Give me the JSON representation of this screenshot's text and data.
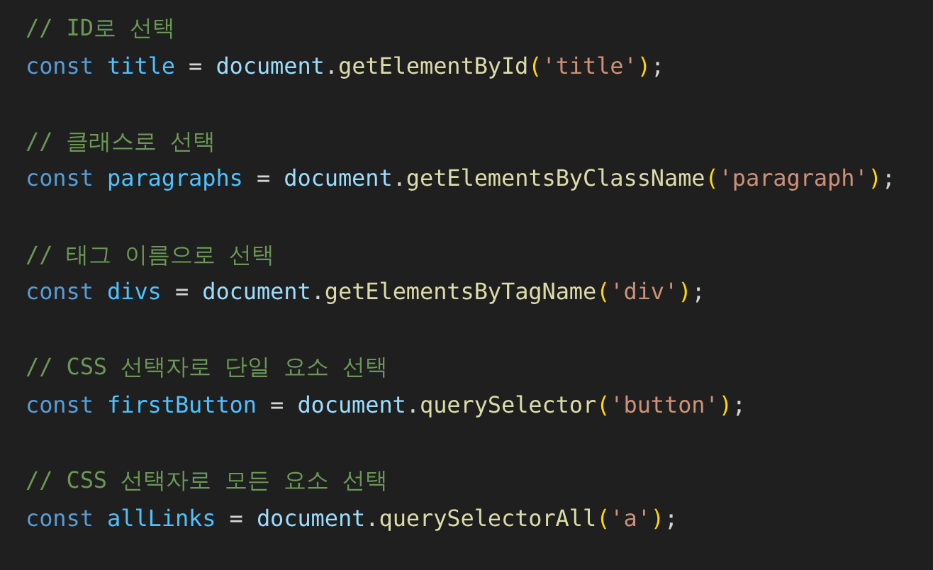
{
  "editor": {
    "lines": [
      {
        "kind": "comment",
        "text": "// ID로 선택"
      },
      {
        "kind": "code",
        "tokens": [
          {
            "kind": "keyword",
            "text": "const"
          },
          {
            "kind": "constant",
            "text": "title"
          },
          {
            "kind": "punct",
            "text": " = "
          },
          {
            "kind": "variable",
            "text": "document"
          },
          {
            "kind": "punct",
            "text": "."
          },
          {
            "kind": "method",
            "text": "getElementById"
          },
          {
            "kind": "paren",
            "text": "("
          },
          {
            "kind": "string",
            "text": "'title'"
          },
          {
            "kind": "paren",
            "text": ")"
          },
          {
            "kind": "punct",
            "text": ";"
          }
        ]
      },
      {
        "kind": "blank"
      },
      {
        "kind": "comment",
        "text": "// 클래스로 선택"
      },
      {
        "kind": "code",
        "tokens": [
          {
            "kind": "keyword",
            "text": "const"
          },
          {
            "kind": "constant",
            "text": "paragraphs"
          },
          {
            "kind": "punct",
            "text": " = "
          },
          {
            "kind": "variable",
            "text": "document"
          },
          {
            "kind": "punct",
            "text": "."
          },
          {
            "kind": "method",
            "text": "getElementsByClassName"
          },
          {
            "kind": "paren",
            "text": "("
          },
          {
            "kind": "string",
            "text": "'paragraph'"
          },
          {
            "kind": "paren",
            "text": ")"
          },
          {
            "kind": "punct",
            "text": ";"
          }
        ]
      },
      {
        "kind": "blank"
      },
      {
        "kind": "comment",
        "text": "// 태그 이름으로 선택"
      },
      {
        "kind": "code",
        "tokens": [
          {
            "kind": "keyword",
            "text": "const"
          },
          {
            "kind": "constant",
            "text": "divs"
          },
          {
            "kind": "punct",
            "text": " = "
          },
          {
            "kind": "variable",
            "text": "document"
          },
          {
            "kind": "punct",
            "text": "."
          },
          {
            "kind": "method",
            "text": "getElementsByTagName"
          },
          {
            "kind": "paren",
            "text": "("
          },
          {
            "kind": "string",
            "text": "'div'"
          },
          {
            "kind": "paren",
            "text": ")"
          },
          {
            "kind": "punct",
            "text": ";"
          }
        ]
      },
      {
        "kind": "blank"
      },
      {
        "kind": "comment",
        "text": "// CSS 선택자로 단일 요소 선택"
      },
      {
        "kind": "code",
        "tokens": [
          {
            "kind": "keyword",
            "text": "const"
          },
          {
            "kind": "constant",
            "text": "firstButton"
          },
          {
            "kind": "punct",
            "text": " = "
          },
          {
            "kind": "variable",
            "text": "document"
          },
          {
            "kind": "punct",
            "text": "."
          },
          {
            "kind": "method",
            "text": "querySelector"
          },
          {
            "kind": "paren",
            "text": "("
          },
          {
            "kind": "string",
            "text": "'button'"
          },
          {
            "kind": "paren",
            "text": ")"
          },
          {
            "kind": "punct",
            "text": ";"
          }
        ]
      },
      {
        "kind": "blank"
      },
      {
        "kind": "comment",
        "text": "// CSS 선택자로 모든 요소 선택"
      },
      {
        "kind": "code",
        "tokens": [
          {
            "kind": "keyword",
            "text": "const"
          },
          {
            "kind": "constant",
            "text": "allLinks"
          },
          {
            "kind": "punct",
            "text": " = "
          },
          {
            "kind": "variable",
            "text": "document"
          },
          {
            "kind": "punct",
            "text": "."
          },
          {
            "kind": "method",
            "text": "querySelectorAll"
          },
          {
            "kind": "paren",
            "text": "("
          },
          {
            "kind": "string",
            "text": "'a'"
          },
          {
            "kind": "paren",
            "text": ")"
          },
          {
            "kind": "punct",
            "text": ";"
          }
        ]
      }
    ]
  }
}
